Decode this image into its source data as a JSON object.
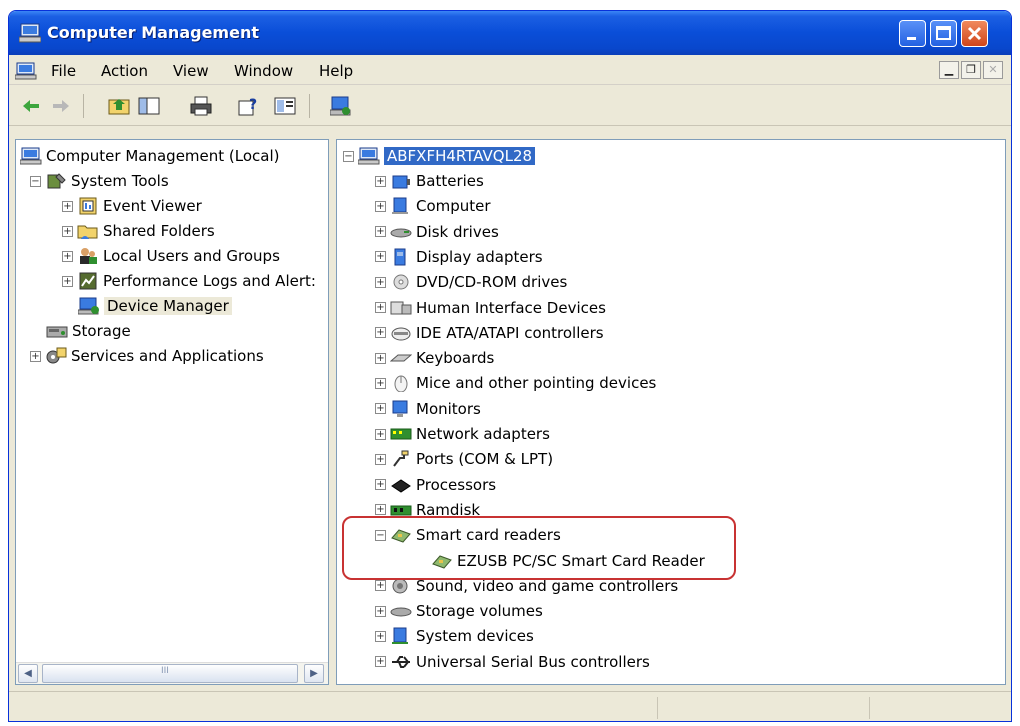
{
  "window": {
    "title": "Computer Management",
    "accent": "#0a4ed8"
  },
  "menu": [
    "File",
    "Action",
    "View",
    "Window",
    "Help"
  ],
  "toolbar": [
    "back-icon",
    "forward-icon",
    "up-folder-icon",
    "show-hide-tree-icon",
    "print-icon",
    "help-icon",
    "properties-icon",
    "device-manager-icon"
  ],
  "left_tree": [
    {
      "label": "Computer Management (Local)",
      "icon": "computer-management-icon"
    },
    {
      "label": "System Tools",
      "icon": "system-tools-icon",
      "expanded": true
    },
    {
      "label": "Event Viewer",
      "icon": "event-viewer-icon"
    },
    {
      "label": "Shared Folders",
      "icon": "shared-folders-icon"
    },
    {
      "label": "Local Users and Groups",
      "icon": "users-icon"
    },
    {
      "label": "Performance Logs and Alert:",
      "icon": "performance-icon"
    },
    {
      "label": "Device Manager",
      "icon": "device-manager-icon",
      "selected": true
    },
    {
      "label": "Storage",
      "icon": "storage-icon"
    },
    {
      "label": "Services and Applications",
      "icon": "services-icon"
    }
  ],
  "right_tree": {
    "root": "ABFXFH4RTAVQL28",
    "items": [
      {
        "label": "Batteries",
        "icon": "battery-icon"
      },
      {
        "label": "Computer",
        "icon": "computer-icon"
      },
      {
        "label": "Disk drives",
        "icon": "disk-drive-icon"
      },
      {
        "label": "Display adapters",
        "icon": "display-adapter-icon"
      },
      {
        "label": "DVD/CD-ROM drives",
        "icon": "dvd-icon"
      },
      {
        "label": "Human Interface Devices",
        "icon": "hid-icon"
      },
      {
        "label": "IDE ATA/ATAPI controllers",
        "icon": "ide-icon"
      },
      {
        "label": "Keyboards",
        "icon": "keyboard-icon"
      },
      {
        "label": "Mice and other pointing devices",
        "icon": "mouse-icon"
      },
      {
        "label": "Monitors",
        "icon": "monitor-icon"
      },
      {
        "label": "Network adapters",
        "icon": "network-adapter-icon"
      },
      {
        "label": "Ports (COM & LPT)",
        "icon": "port-icon"
      },
      {
        "label": "Processors",
        "icon": "processor-icon"
      },
      {
        "label": "Ramdisk",
        "icon": "ramdisk-icon"
      },
      {
        "label": "Smart card readers",
        "icon": "smart-card-icon",
        "expanded": true
      },
      {
        "label": "EZUSB PC/SC Smart Card Reader",
        "icon": "smart-card-icon",
        "child": true
      },
      {
        "label": "Sound, video and game controllers",
        "icon": "sound-icon"
      },
      {
        "label": "Storage volumes",
        "icon": "storage-volume-icon"
      },
      {
        "label": "System devices",
        "icon": "system-device-icon"
      },
      {
        "label": "Universal Serial Bus controllers",
        "icon": "usb-icon"
      }
    ]
  },
  "scrollbar": {
    "thumb_grip": "III"
  }
}
